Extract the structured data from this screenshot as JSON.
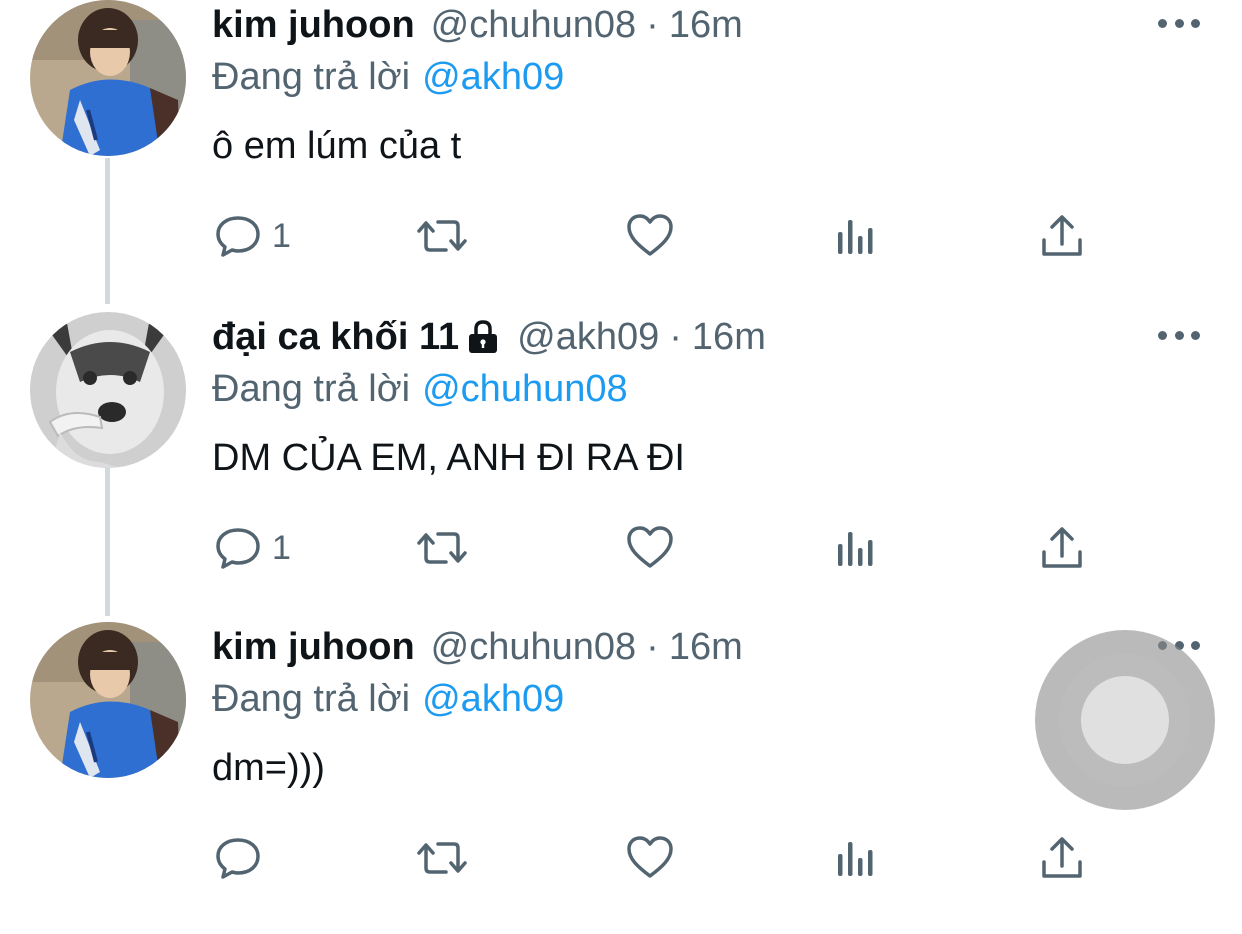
{
  "colors": {
    "accent": "#1d9bf0",
    "muted": "#536471",
    "text": "#0f1419",
    "thread_line": "#cfd9de"
  },
  "tweets": [
    {
      "name": "kim juhoon",
      "handle": "@chuhun08",
      "separator": "·",
      "time": "16m",
      "reply_prefix": "Đang trả lời",
      "reply_to": "@akh09",
      "text": "ô em lúm của t",
      "reply_count": "1",
      "locked": false,
      "avatar": "person-avatar"
    },
    {
      "name": "đại ca khối 11",
      "handle": "@akh09",
      "separator": "·",
      "time": "16m",
      "reply_prefix": "Đang trả lời",
      "reply_to": "@chuhun08",
      "text": "DM CỦA EM, ANH ĐI RA ĐI",
      "reply_count": "1",
      "locked": true,
      "avatar": "husky-avatar"
    },
    {
      "name": "kim juhoon",
      "handle": "@chuhun08",
      "separator": "·",
      "time": "16m",
      "reply_prefix": "Đang trả lời",
      "reply_to": "@akh09",
      "text": "dm=)))",
      "reply_count": "",
      "locked": false,
      "avatar": "person-avatar"
    }
  ],
  "icons": [
    "more-icon",
    "reply-icon",
    "retweet-icon",
    "like-icon",
    "analytics-icon",
    "share-icon",
    "lock-icon"
  ],
  "overlay": {
    "icon": "assistive-touch-button"
  }
}
